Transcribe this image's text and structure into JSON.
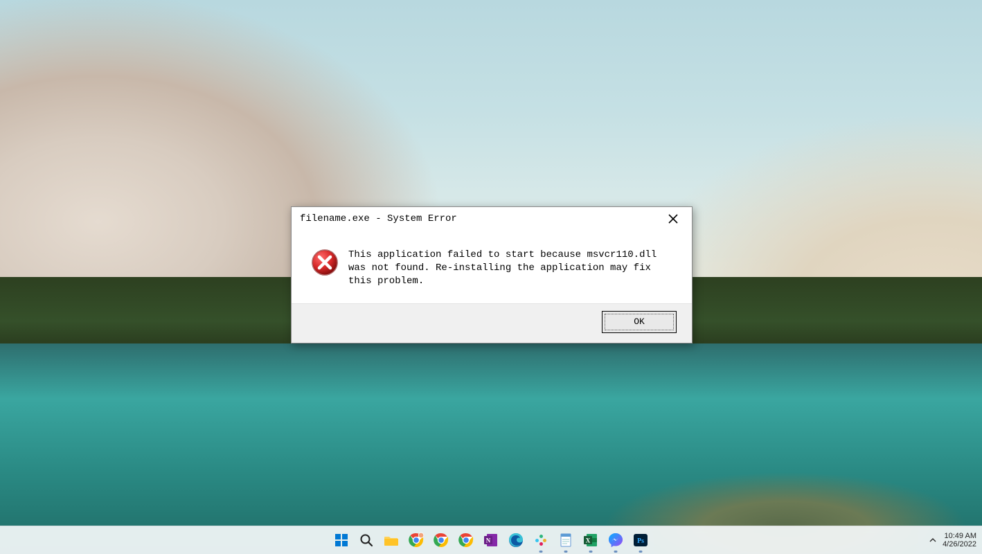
{
  "dialog": {
    "title": "filename.exe - System Error",
    "message": "This application failed to start because msvcr110.dll was not found. Re-installing the application may fix this problem.",
    "ok_label": "OK"
  },
  "taskbar": {
    "items": [
      {
        "name": "start",
        "icon": "windows"
      },
      {
        "name": "search",
        "icon": "magnifier"
      },
      {
        "name": "explorer",
        "icon": "folder"
      },
      {
        "name": "chrome-profile-1",
        "icon": "chrome",
        "badge": true
      },
      {
        "name": "chrome-profile-2",
        "icon": "chrome"
      },
      {
        "name": "chrome-profile-3",
        "icon": "chrome"
      },
      {
        "name": "onenote",
        "icon": "onenote"
      },
      {
        "name": "edge",
        "icon": "edge"
      },
      {
        "name": "slack",
        "icon": "slack",
        "running": true
      },
      {
        "name": "notepad",
        "icon": "notepad",
        "running": true
      },
      {
        "name": "excel",
        "icon": "excel",
        "running": true
      },
      {
        "name": "messenger",
        "icon": "messenger",
        "running": true
      },
      {
        "name": "photoshop",
        "icon": "photoshop",
        "running": true
      }
    ]
  },
  "tray": {
    "time": "10:49 AM",
    "date": "4/26/2022"
  }
}
